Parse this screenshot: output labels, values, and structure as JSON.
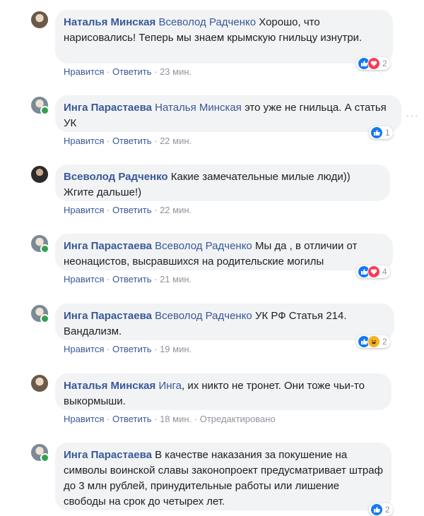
{
  "comments": [
    {
      "author": "Наталья Минская",
      "mention": "Всеволод Радченко",
      "text": " Хорошо, что нарисовались! Теперь мы знаем крымскую гнильцу изнутри.",
      "like": "Нравится",
      "reply": "Ответить",
      "time": "23 мин.",
      "reaction_count": "2",
      "reactions": [
        "like-icon",
        "love-icon"
      ]
    },
    {
      "author": "Инга Парастаева",
      "mention": "Наталья Минская",
      "text": " это уже не гнильца. А статья УК",
      "like": "Нравится",
      "reply": "Ответить",
      "time": "22 мин.",
      "reaction_count": "1",
      "reactions": [
        "like-icon"
      ]
    },
    {
      "author": "Всеволод Радченко",
      "mention": "",
      "text": " Какие замечательные милые люди)) Жгите дальше!)",
      "like": "Нравится",
      "reply": "Ответить",
      "time": "22 мин."
    },
    {
      "author": "Инга Парастаева",
      "mention": "Всеволод Радченко",
      "text": " Мы да , в отличии от неонацистов, высравшихся на родительские могилы",
      "like": "Нравится",
      "reply": "Ответить",
      "time": "21 мин.",
      "reaction_count": "4",
      "reactions": [
        "like-icon",
        "love-icon"
      ]
    },
    {
      "author": "Инга Парастаева",
      "mention": "Всеволод Радченко",
      "text": " УК РФ Статья 214. Вандализм.",
      "like": "Нравится",
      "reply": "Ответить",
      "time": "19 мин.",
      "reaction_count": "2",
      "reactions": [
        "like-icon",
        "haha-icon"
      ]
    },
    {
      "author": "Наталья Минская",
      "mention": "Инга",
      "text": ", их никто не тронет. Они тоже чьи-то выкормыши.",
      "like": "Нравится",
      "reply": "Ответить",
      "time": "18 мин.",
      "edited": "Отредактировано"
    },
    {
      "author": "Инга Парастаева",
      "mention": "",
      "text": " В качестве наказания за покушение на символы воинской славы законопроект предусматривает штраф до 3 млн рублей, принудительные работы или лишение свободы на срок до четырех лет.",
      "reaction_count": "2",
      "reactions": [
        "like-icon"
      ]
    }
  ],
  "separator": " · ",
  "more_options": "···",
  "colors": {
    "link": "#385898",
    "bubble": "#f2f3f5",
    "meta": "#90949c",
    "online": "#31a24c",
    "like": "#1877f2",
    "love": "#f33e58",
    "haha": "#f7b125"
  }
}
